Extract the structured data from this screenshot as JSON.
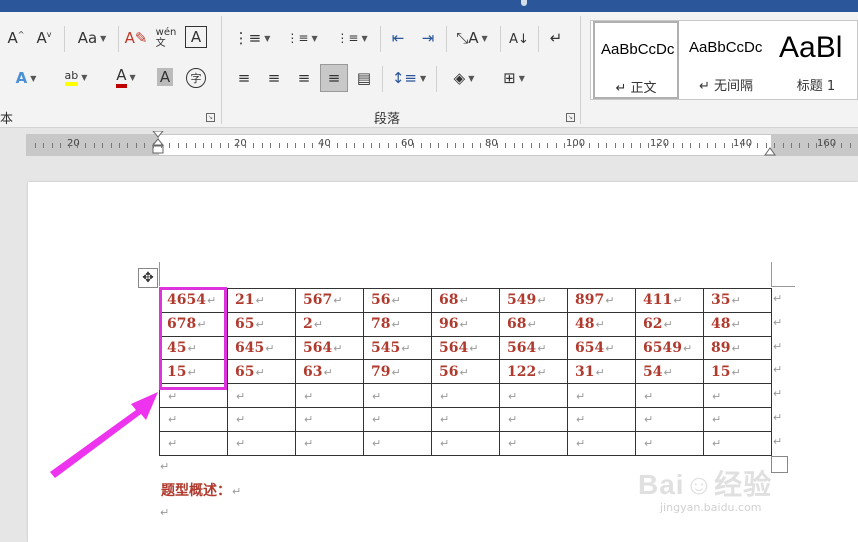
{
  "ribbon": {
    "font_group_label": "本",
    "paragraph_group_label": "段落",
    "font_row1": [
      {
        "name": "grow-font-icon",
        "glyph": "A˄"
      },
      {
        "name": "shrink-font-icon",
        "glyph": "A˅"
      },
      {
        "name": "change-case-icon",
        "glyph": "Aa"
      },
      {
        "name": "clear-format-icon",
        "glyph": "A⁄"
      },
      {
        "name": "phonetic-guide-icon",
        "glyph": "wén\n文"
      },
      {
        "name": "char-border-icon",
        "glyph": "A"
      }
    ],
    "font_row2": [
      {
        "name": "text-effects-icon",
        "glyph": "A"
      },
      {
        "name": "highlight-icon",
        "glyph": "ab"
      },
      {
        "name": "font-color-icon",
        "glyph": "A"
      },
      {
        "name": "char-shading-icon",
        "glyph": "A"
      },
      {
        "name": "enclose-char-icon",
        "glyph": "字"
      }
    ],
    "para_row1": [
      {
        "name": "bullets-icon",
        "glyph": "☰"
      },
      {
        "name": "numbering-icon",
        "glyph": "☰"
      },
      {
        "name": "multilevel-icon",
        "glyph": "☰"
      },
      {
        "name": "decrease-indent-icon",
        "glyph": "⇤"
      },
      {
        "name": "increase-indent-icon",
        "glyph": "⇥"
      },
      {
        "name": "asian-layout-icon",
        "glyph": "A"
      },
      {
        "name": "sort-icon",
        "glyph": "A↓"
      },
      {
        "name": "show-marks-icon",
        "glyph": "↵"
      }
    ],
    "para_row2": [
      {
        "name": "align-left-icon",
        "glyph": "≡"
      },
      {
        "name": "align-center-icon",
        "glyph": "≡"
      },
      {
        "name": "align-right-icon",
        "glyph": "≡"
      },
      {
        "name": "justify-icon",
        "glyph": "≡"
      },
      {
        "name": "distribute-icon",
        "glyph": "≡"
      },
      {
        "name": "line-spacing-icon",
        "glyph": "↕"
      },
      {
        "name": "shading-icon",
        "glyph": "◇"
      },
      {
        "name": "borders-icon",
        "glyph": "⊞"
      }
    ],
    "styles": [
      {
        "sample": "AaBbCcDc",
        "name": "↵ 正文"
      },
      {
        "sample": "AaBbCcDc",
        "name": "↵ 无间隔"
      },
      {
        "sample": "AaBl",
        "name": "标题 1"
      }
    ]
  },
  "ruler": {
    "labels": [
      "20",
      "20",
      "40",
      "60",
      "80",
      "100",
      "120",
      "140",
      "160"
    ]
  },
  "table": {
    "rows": [
      [
        "4654",
        "21",
        "567",
        "56",
        "68",
        "549",
        "897",
        "411",
        "35"
      ],
      [
        "678",
        "65",
        "2",
        "78",
        "96",
        "68",
        "48",
        "62",
        "48"
      ],
      [
        "45",
        "645",
        "564",
        "545",
        "564",
        "564",
        "654",
        "6549",
        "89"
      ],
      [
        "15",
        "65",
        "63",
        "79",
        "56",
        "122",
        "31",
        "54",
        "15"
      ],
      [
        "",
        "",
        "",
        "",
        "",
        "",
        "",
        "",
        ""
      ],
      [
        "",
        "",
        "",
        "",
        "",
        "",
        "",
        "",
        ""
      ],
      [
        "",
        "",
        "",
        "",
        "",
        "",
        "",
        "",
        ""
      ]
    ],
    "paragraph_mark": "↵"
  },
  "document": {
    "summary_label": "题型概述：",
    "paragraph_mark": "↵"
  },
  "watermark": {
    "brand": "Bai☺经验",
    "url": "jingyan.baidu.com"
  },
  "colors": {
    "title_bar": "#2b579a",
    "cell_text": "#b03a2e",
    "highlight_box": "#dd33dd",
    "arrow": "#ee33ee",
    "highlight_yellow": "#ffff00",
    "font_red": "#c00000"
  }
}
